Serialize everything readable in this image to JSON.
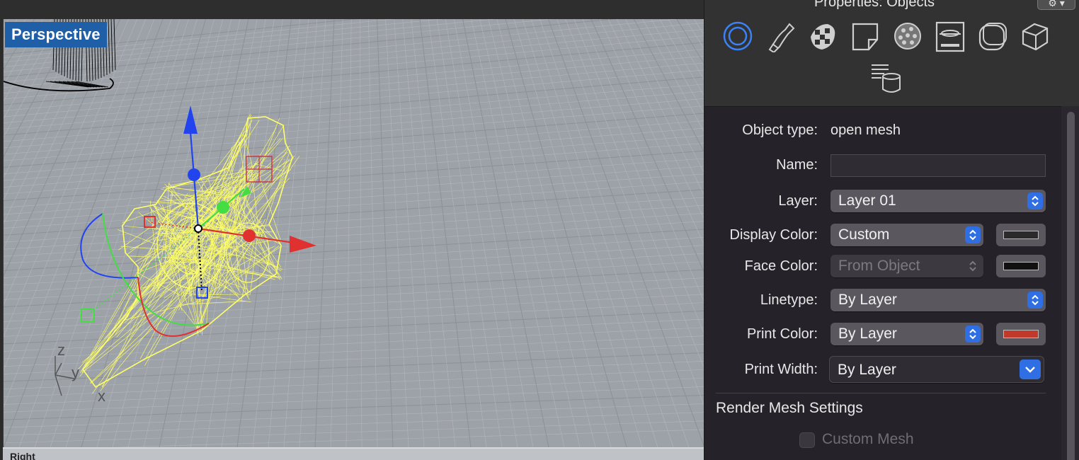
{
  "viewport": {
    "label": "Perspective",
    "axis_labels": {
      "z": "z",
      "y": "y",
      "x": "x"
    },
    "bottom_viewport_label": "Right"
  },
  "panel": {
    "title": "Properties: Objects",
    "gear_label": "⚙ ▾",
    "tabs": [
      "object-properties-icon",
      "curve-piping-icon",
      "material-checker-icon",
      "page-note-icon",
      "texture-displacement-icon",
      "render-cap-icon",
      "rounded-box-icon",
      "box-edge-icon",
      "user-text-database-icon"
    ],
    "rows": {
      "object_type": {
        "label": "Object type:",
        "value": "open mesh"
      },
      "name": {
        "label": "Name:",
        "value": ""
      },
      "layer": {
        "label": "Layer:",
        "value": "Layer 01"
      },
      "display_color": {
        "label": "Display Color:",
        "value": "Custom",
        "swatch": "#2b2b2b"
      },
      "face_color": {
        "label": "Face Color:",
        "value": "From Object",
        "swatch": "#111111"
      },
      "linetype": {
        "label": "Linetype:",
        "value": "By Layer"
      },
      "print_color": {
        "label": "Print Color:",
        "value": "By Layer",
        "swatch": "#c0392b"
      },
      "print_width": {
        "label": "Print Width:",
        "value": "By Layer"
      }
    },
    "render_mesh": {
      "title": "Render Mesh Settings",
      "custom_mesh_label": "Custom Mesh",
      "custom_mesh_checked": false
    }
  },
  "colors": {
    "accent": "#2f6fe3",
    "selection": "#ffff66",
    "gumball_x": "#e03030",
    "gumball_y": "#44dd44",
    "gumball_z": "#2244ee"
  }
}
